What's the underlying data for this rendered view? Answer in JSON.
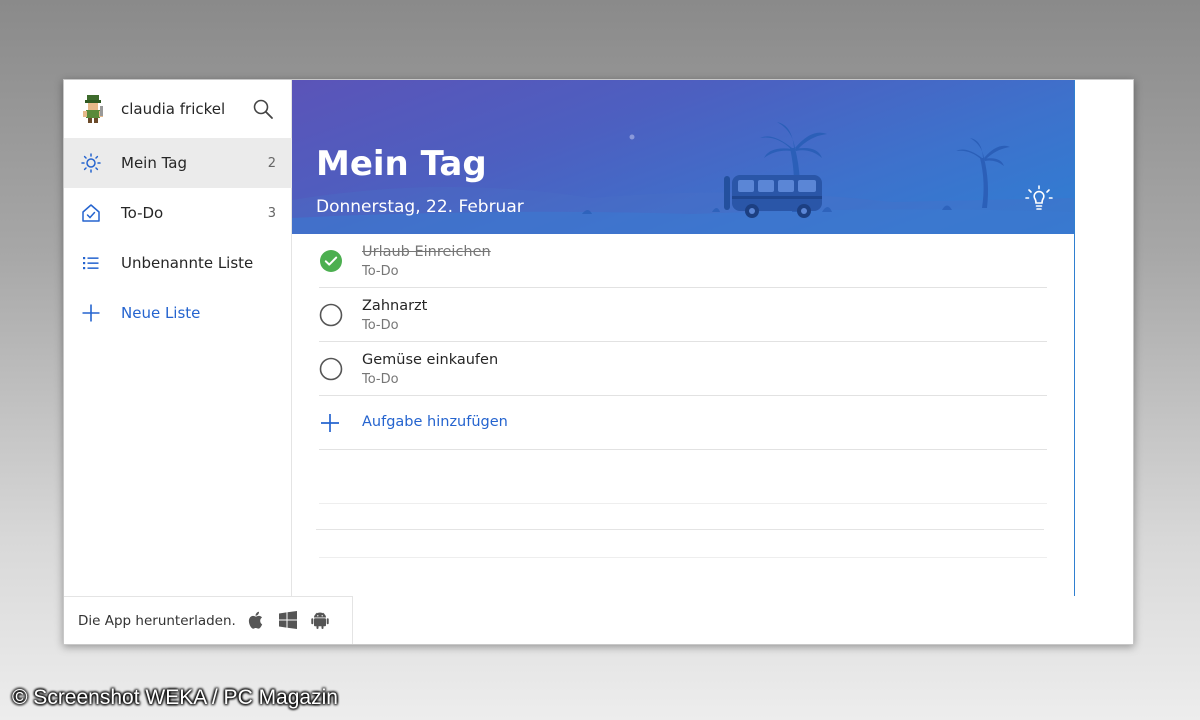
{
  "profile": {
    "name": "claudia frickel"
  },
  "sidebar": {
    "items": [
      {
        "label": "Mein Tag",
        "count": "2",
        "icon": "sun-icon",
        "active": true
      },
      {
        "label": "To-Do",
        "count": "3",
        "icon": "home-check-icon",
        "active": false
      },
      {
        "label": "Unbenannte Liste",
        "count": "",
        "icon": "list-icon",
        "active": false
      },
      {
        "label": "Neue Liste",
        "count": "",
        "icon": "plus-icon",
        "active": false
      }
    ],
    "footer": {
      "text": "Die App herunterladen.",
      "platforms": [
        "apple-icon",
        "windows-icon",
        "android-icon"
      ]
    }
  },
  "header": {
    "title": "Mein Tag",
    "date": "Donnerstag, 22. Februar"
  },
  "tasks": [
    {
      "title": "Urlaub Einreichen",
      "list": "To-Do",
      "done": true
    },
    {
      "title": "Zahnarzt",
      "list": "To-Do",
      "done": false
    },
    {
      "title": "Gemüse einkaufen",
      "list": "To-Do",
      "done": false
    }
  ],
  "add_task": {
    "label": "Aufgabe hinzufügen"
  },
  "watermark": "© Screenshot WEKA / PC Magazin",
  "colors": {
    "accent": "#2564cf",
    "done_green": "#4caf50",
    "header_start": "#5b54b8",
    "header_end": "#2f7ed3"
  }
}
